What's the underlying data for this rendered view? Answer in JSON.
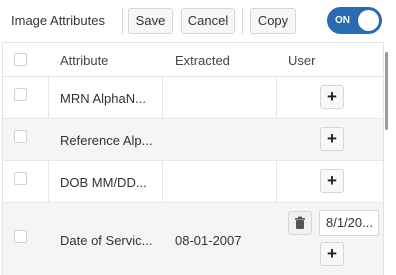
{
  "toolbar": {
    "title": "Image Attributes",
    "save_label": "Save",
    "cancel_label": "Cancel",
    "copy_label": "Copy",
    "toggle_label": "ON",
    "toggle_on": true
  },
  "table": {
    "columns": [
      "Attribute",
      "Extracted",
      "User"
    ],
    "rows": [
      {
        "attribute": "MRN AlphaN...",
        "extracted": "",
        "user": ""
      },
      {
        "attribute": "Reference Alp...",
        "extracted": "",
        "user": ""
      },
      {
        "attribute": "DOB MM/DD...",
        "extracted": "",
        "user": ""
      },
      {
        "attribute": "Date of Servic...",
        "extracted": "08-01-2007",
        "user": "8/1/20..."
      }
    ],
    "add_symbol": "+"
  },
  "colors": {
    "accent": "#2a6ab1",
    "row_alt": "#f5f5f5",
    "border": "#e3e3e3"
  },
  "icons": [
    "plus-icon",
    "trash-icon",
    "checkbox"
  ]
}
